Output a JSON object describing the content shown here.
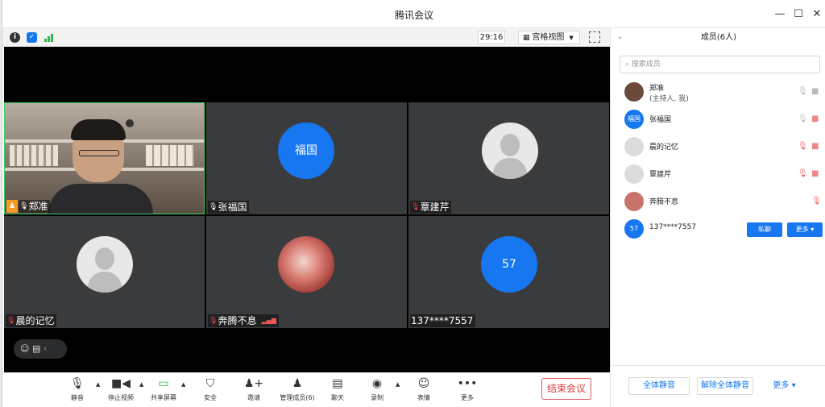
{
  "window": {
    "title": "腾讯会议"
  },
  "status_strip": {
    "timer": "29:16",
    "view_mode": "宫格视图"
  },
  "tiles": [
    {
      "name": "郑准"
    },
    {
      "name": "张福国",
      "avatar_text": "福国"
    },
    {
      "name": "覃建芹"
    },
    {
      "name": "晨的记忆"
    },
    {
      "name": "奔腾不息"
    },
    {
      "name": "137****7557",
      "avatar_text": "57"
    }
  ],
  "toolbar": {
    "mute": "静音",
    "stop_video": "停止视频",
    "share_screen": "共享屏幕",
    "security": "安全",
    "invite": "邀请",
    "manage_members": "管理成员(6)",
    "chat": "聊天",
    "record": "录制",
    "emoji": "表情",
    "more": "更多",
    "end_meeting": "结束会议"
  },
  "panel": {
    "title": "成员(6人)",
    "search_placeholder": "搜索成员",
    "members": [
      {
        "name": "郑准",
        "sub": "(主持人, 我)"
      },
      {
        "name": "张福国",
        "avatar_text": "福国"
      },
      {
        "name": "晨的记忆"
      },
      {
        "name": "覃建芹"
      },
      {
        "name": "奔腾不息"
      },
      {
        "name": "137****7557",
        "avatar_text": "57",
        "btn_private": "私聊",
        "btn_more": "更多 ▾"
      }
    ],
    "footer": {
      "mute_all": "全体静音",
      "unmute_all": "解除全体静音",
      "more": "更多 ▾"
    }
  },
  "colors": {
    "accent": "#1677f0",
    "end_red": "#e03c3c",
    "stage_bg": "#000000",
    "tile_bg": "#3a3b3d"
  }
}
